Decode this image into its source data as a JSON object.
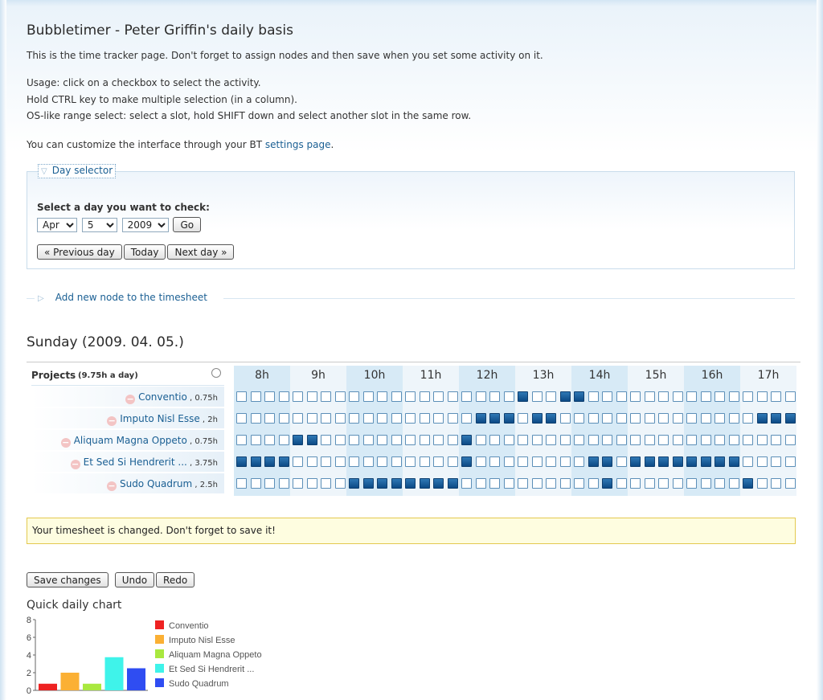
{
  "page": {
    "title": "Bubbletimer - Peter Griffin's daily basis",
    "intro": "This is the time tracker page. Don't forget to assign nodes and then save when you set some activity on it.",
    "usage": [
      "Usage: click on a checkbox to select the activity.",
      "Hold CTRL key to make multiple selection (in a column).",
      "OS-like range select: select a slot, hold SHIFT down and select another slot in the same row."
    ],
    "customize_prefix": "You can customize the interface through your BT ",
    "customize_link": "settings page",
    "customize_suffix": "."
  },
  "day_selector": {
    "legend": "Day selector",
    "prompt": "Select a day you want to check:",
    "month": "Apr",
    "day": "5",
    "year": "2009",
    "go_label": "Go",
    "prev_label": "« Previous day",
    "today_label": "Today",
    "next_label": "Next day »"
  },
  "add_node": {
    "label": "Add new node to the timesheet"
  },
  "timesheet": {
    "day_title": "Sunday (2009. 04. 05.)",
    "projects_label": "Projects",
    "projects_total": "(9.75h a day)",
    "hours": [
      "8h",
      "9h",
      "10h",
      "11h",
      "12h",
      "13h",
      "14h",
      "15h",
      "16h",
      "17h"
    ],
    "projects": [
      {
        "name": "Conventio",
        "hours": ", 0.75h",
        "slots": [
          0,
          0,
          0,
          0,
          0,
          0,
          0,
          0,
          0,
          0,
          0,
          0,
          0,
          0,
          0,
          0,
          0,
          0,
          0,
          0,
          1,
          0,
          0,
          1,
          1,
          0,
          0,
          0,
          0,
          0,
          0,
          0,
          0,
          0,
          0,
          0,
          0,
          0,
          0,
          0
        ]
      },
      {
        "name": "Imputo Nisl Esse",
        "hours": ", 2h",
        "slots": [
          0,
          0,
          0,
          0,
          0,
          0,
          0,
          0,
          0,
          0,
          0,
          0,
          0,
          0,
          0,
          0,
          0,
          1,
          1,
          1,
          0,
          1,
          1,
          0,
          0,
          0,
          0,
          0,
          0,
          0,
          0,
          0,
          0,
          0,
          0,
          0,
          0,
          1,
          1,
          1
        ]
      },
      {
        "name": "Aliquam Magna Oppeto",
        "hours": ", 0.75h",
        "slots": [
          0,
          0,
          0,
          0,
          1,
          1,
          0,
          0,
          0,
          0,
          0,
          0,
          0,
          0,
          0,
          0,
          1,
          0,
          0,
          0,
          0,
          0,
          0,
          0,
          0,
          0,
          0,
          0,
          0,
          0,
          0,
          0,
          0,
          0,
          0,
          0,
          0,
          0,
          0,
          0
        ]
      },
      {
        "name": "Et Sed Si Hendrerit ...",
        "hours": ", 3.75h",
        "slots": [
          1,
          1,
          1,
          1,
          0,
          0,
          0,
          0,
          0,
          0,
          0,
          0,
          0,
          0,
          0,
          0,
          1,
          0,
          0,
          0,
          0,
          0,
          0,
          0,
          0,
          1,
          1,
          0,
          1,
          1,
          1,
          1,
          1,
          1,
          1,
          1,
          0,
          0,
          0,
          0
        ]
      },
      {
        "name": "Sudo Quadrum",
        "hours": ", 2.5h",
        "slots": [
          0,
          0,
          0,
          0,
          0,
          0,
          0,
          0,
          1,
          1,
          1,
          1,
          1,
          1,
          1,
          1,
          0,
          0,
          0,
          0,
          0,
          0,
          0,
          0,
          0,
          0,
          1,
          0,
          0,
          0,
          0,
          0,
          0,
          0,
          0,
          0,
          1,
          0,
          0,
          0
        ]
      }
    ]
  },
  "notice": "Your timesheet is changed. Don't forget to save it!",
  "actions": {
    "save": "Save changes",
    "undo": "Undo",
    "redo": "Redo"
  },
  "chart_data": {
    "type": "bar",
    "title": "Quick daily chart",
    "categories": [
      "Conventio",
      "Imputo Nisl Esse",
      "Aliquam Magna Oppeto",
      "Et Sed Si Hendrerit ...",
      "Sudo Quadrum"
    ],
    "values": [
      0.75,
      2,
      0.75,
      3.75,
      2.5
    ],
    "colors": [
      "#ee2222",
      "#fbb034",
      "#a9e83f",
      "#3ff3ea",
      "#2f4df2"
    ],
    "ylim": [
      0,
      8
    ],
    "yticks": [
      "0",
      "2",
      "4",
      "6",
      "8"
    ],
    "legend_position": "right"
  }
}
